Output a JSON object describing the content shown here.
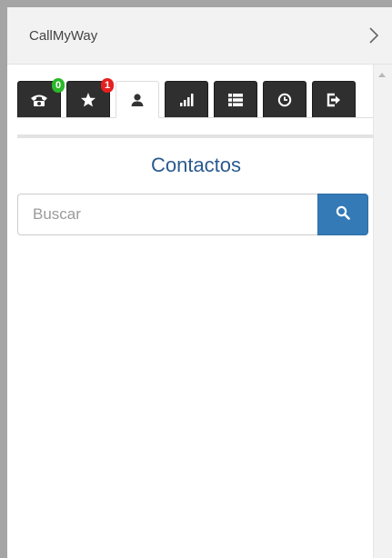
{
  "app": {
    "title": "CallMyWay"
  },
  "tabs": [
    {
      "name": "calls",
      "icon": "phone-icon",
      "badge": "0",
      "badge_color": "#2bb82b",
      "active": false
    },
    {
      "name": "favorites",
      "icon": "star-icon",
      "badge": "1",
      "badge_color": "#e52020",
      "active": false
    },
    {
      "name": "contacts",
      "icon": "user-icon",
      "active": true
    },
    {
      "name": "signal",
      "icon": "signal-icon",
      "active": false
    },
    {
      "name": "list",
      "icon": "list-icon",
      "active": false
    },
    {
      "name": "history",
      "icon": "clock-icon",
      "active": false
    },
    {
      "name": "logout",
      "icon": "logout-icon",
      "active": false
    }
  ],
  "main": {
    "heading": "Contactos",
    "search": {
      "placeholder": "Buscar",
      "value": ""
    }
  },
  "colors": {
    "accent": "#337ab7",
    "heading": "#2a5a8f",
    "tab_dark": "#2f2f2f"
  }
}
